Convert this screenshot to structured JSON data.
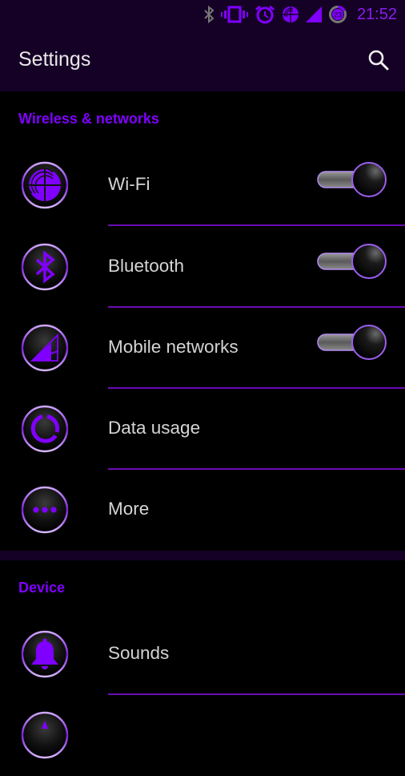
{
  "status_bar": {
    "time": "21:52",
    "battery_level": "23",
    "icons": [
      "bluetooth-icon",
      "vibrate-icon",
      "alarm-icon",
      "wifi-icon",
      "signal-icon",
      "battery-icon"
    ]
  },
  "app_bar": {
    "title": "Settings",
    "search_icon": "search-icon"
  },
  "colors": {
    "accent": "#8000ff",
    "bar_background": "#150126",
    "divider": "#6a0bb3",
    "text": "#d4d4d4"
  },
  "sections": [
    {
      "header": "Wireless & networks",
      "items": [
        {
          "label": "Wi-Fi",
          "icon": "wifi-icon",
          "toggle": true,
          "toggle_on": true
        },
        {
          "label": "Bluetooth",
          "icon": "bluetooth-icon",
          "toggle": true,
          "toggle_on": true
        },
        {
          "label": "Mobile networks",
          "icon": "signal-icon",
          "toggle": true,
          "toggle_on": true
        },
        {
          "label": "Data usage",
          "icon": "data-usage-icon",
          "toggle": false
        },
        {
          "label": "More",
          "icon": "more-icon",
          "toggle": false
        }
      ]
    },
    {
      "header": "Device",
      "items": [
        {
          "label": "Sounds",
          "icon": "bell-icon",
          "toggle": false
        },
        {
          "label": "",
          "icon": "partial-icon",
          "toggle": false
        }
      ]
    }
  ]
}
